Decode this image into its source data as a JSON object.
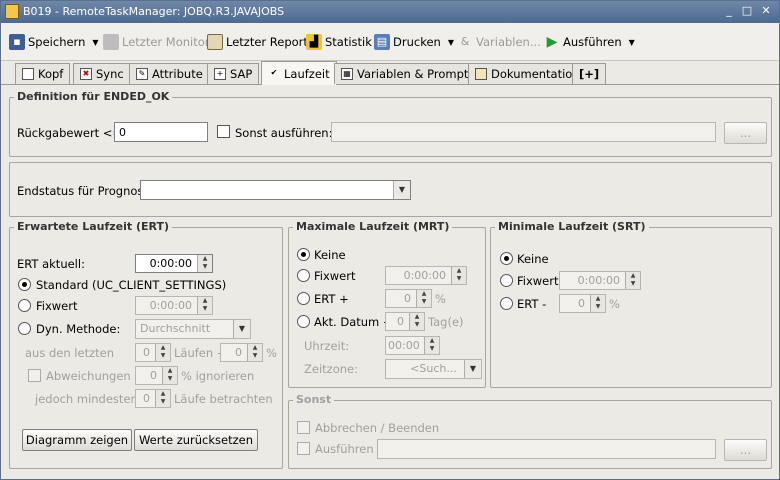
{
  "window": {
    "title": "B019 - RemoteTaskManager: JOBQ.R3.JAVAJOBS",
    "min": "_",
    "max": "□",
    "close": "✕"
  },
  "toolbar": {
    "speichern": "Speichern",
    "letzter_monitor": "Letzter Monitor",
    "letzter_report": "Letzter Report",
    "statistik": "Statistik",
    "drucken": "Drucken",
    "variablen": "Variablen...",
    "ausfuehren": "Ausführen"
  },
  "tabs": [
    "Kopf",
    "Sync",
    "Attribute",
    "SAP",
    "Laufzeit",
    "Variablen & Prompts",
    "Dokumentation",
    "[+]"
  ],
  "ended_ok": {
    "title": "Definition für ENDED_OK",
    "rueckgabe_label": "Rückgabewert <=:",
    "rueckgabe_value": "0",
    "sonst_label": "Sonst ausführen:",
    "sonst_value": "",
    "browse": "..."
  },
  "endstatus": {
    "label": "Endstatus für Prognose:",
    "value": ""
  },
  "ert": {
    "title": "Erwartete Laufzeit (ERT)",
    "aktuell_label": "ERT aktuell:",
    "aktuell_value": "0:00:00",
    "standard_label": "Standard (UC_CLIENT_SETTINGS)",
    "fixwert_label": "Fixwert",
    "fixwert_value": "0:00:00",
    "dyn_label": "Dyn. Methode:",
    "dyn_value": "Durchschnitt",
    "aus_den_letzten": "aus den letzten",
    "laeufe_value": "0",
    "laeufe_plus": "Läufen +",
    "pct_value": "0",
    "pct": "%",
    "abweichungen_label": "Abweichungen >",
    "abw_value": "0",
    "ignorieren": "% ignorieren",
    "mindestens_label": "jedoch mindestens:",
    "mind_value": "0",
    "betrachten": "Läufe betrachten",
    "diagramm_button": "Diagramm zeigen",
    "reset_button": "Werte zurücksetzen"
  },
  "mrt": {
    "title": "Maximale Laufzeit (MRT)",
    "keine": "Keine",
    "fixwert": "Fixwert",
    "fixwert_value": "0:00:00",
    "ert_plus": "ERT +",
    "ert_plus_value": "0",
    "pct": "%",
    "akt_datum": "Akt. Datum +",
    "akt_datum_value": "0",
    "tage": "Tag(e)",
    "uhrzeit_label": "Uhrzeit:",
    "uhrzeit_value": "00:00",
    "zeitzone_label": "Zeitzone:",
    "zeitzone_value": "<Such..."
  },
  "srt": {
    "title": "Minimale Laufzeit (SRT)",
    "keine": "Keine",
    "fixwert": "Fixwert",
    "fixwert_value": "0:00:00",
    "ert_minus": "ERT -",
    "ert_minus_value": "0",
    "pct": "%"
  },
  "sonst": {
    "title": "Sonst",
    "abbrechen": "Abbrechen / Beenden",
    "ausfuehren": "Ausführen",
    "ausfuehren_value": "",
    "browse": "..."
  }
}
